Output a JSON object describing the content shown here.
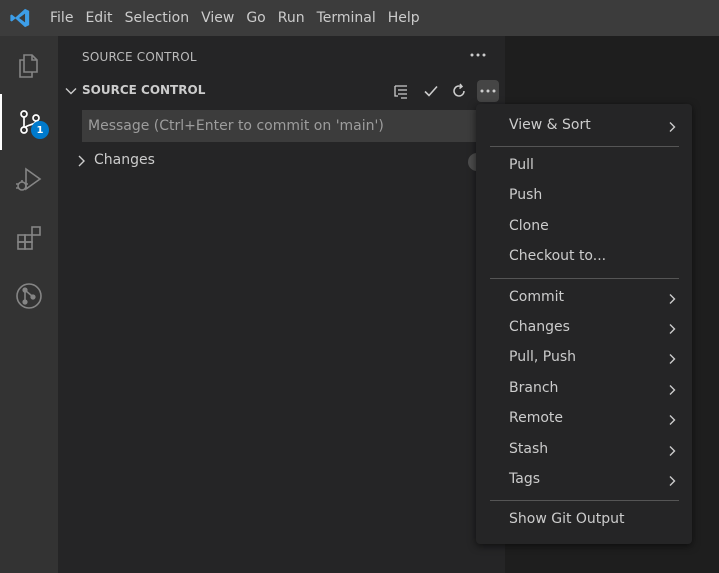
{
  "menubar": {
    "items": [
      "File",
      "Edit",
      "Selection",
      "View",
      "Go",
      "Run",
      "Terminal",
      "Help"
    ]
  },
  "activity_bar": {
    "items": [
      {
        "icon": "files-icon"
      },
      {
        "icon": "source-control-icon",
        "badge": "1",
        "active": true
      },
      {
        "icon": "run-debug-icon"
      },
      {
        "icon": "extensions-icon"
      },
      {
        "icon": "git-remote-icon"
      }
    ]
  },
  "sidebar": {
    "header": "SOURCE CONTROL",
    "section_title": "SOURCE CONTROL",
    "commit_placeholder": "Message (Ctrl+Enter to commit on 'main')",
    "changes_label": "Changes",
    "toolbar_icons": [
      "view-as-tree-icon",
      "commit-check-icon",
      "refresh-icon",
      "more-actions-icon"
    ]
  },
  "context_menu": {
    "groups": [
      [
        {
          "label": "View & Sort",
          "submenu": true
        }
      ],
      [
        {
          "label": "Pull",
          "submenu": false
        },
        {
          "label": "Push",
          "submenu": false
        },
        {
          "label": "Clone",
          "submenu": false
        },
        {
          "label": "Checkout to...",
          "submenu": false
        }
      ],
      [
        {
          "label": "Commit",
          "submenu": true
        },
        {
          "label": "Changes",
          "submenu": true
        },
        {
          "label": "Pull, Push",
          "submenu": true
        },
        {
          "label": "Branch",
          "submenu": true
        },
        {
          "label": "Remote",
          "submenu": true
        },
        {
          "label": "Stash",
          "submenu": true
        },
        {
          "label": "Tags",
          "submenu": true
        }
      ],
      [
        {
          "label": "Show Git Output",
          "submenu": false
        }
      ]
    ]
  },
  "colors": {
    "accent": "#007acc",
    "titlebar": "#3c3c3c",
    "activitybar": "#333333",
    "sidebar": "#252526",
    "editor": "#1e1e1e"
  }
}
